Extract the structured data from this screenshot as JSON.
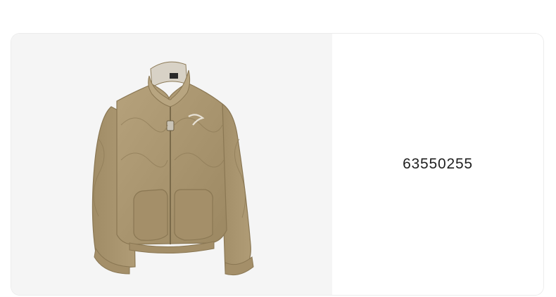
{
  "product": {
    "id": "63550255",
    "image": {
      "subject": "quilted-bomber-jacket",
      "background_color": "#f5f5f5",
      "jacket_color": "#a8946f"
    }
  }
}
